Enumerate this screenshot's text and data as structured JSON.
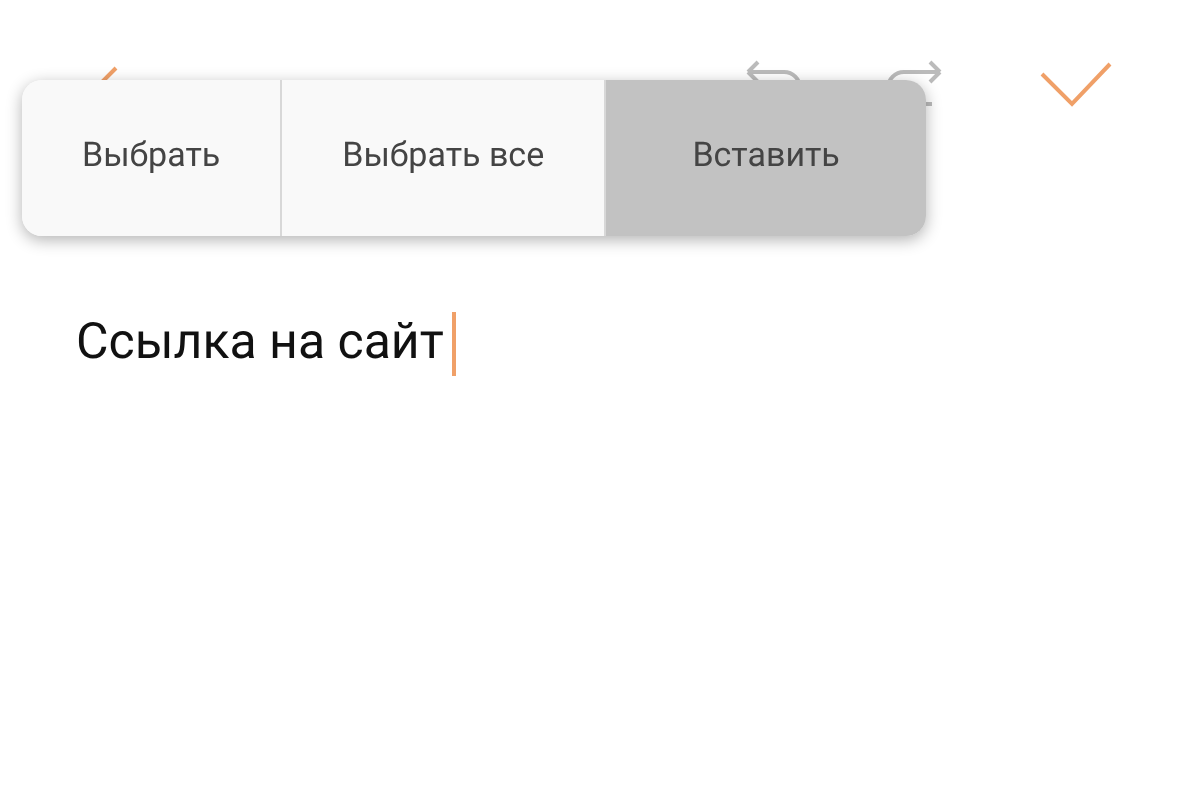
{
  "context_menu": {
    "items": [
      {
        "label": "Выбрать",
        "selected": false
      },
      {
        "label": "Выбрать все",
        "selected": false
      },
      {
        "label": "Вставить",
        "selected": true
      }
    ]
  },
  "editor": {
    "value": "Ссылка на сайт"
  }
}
